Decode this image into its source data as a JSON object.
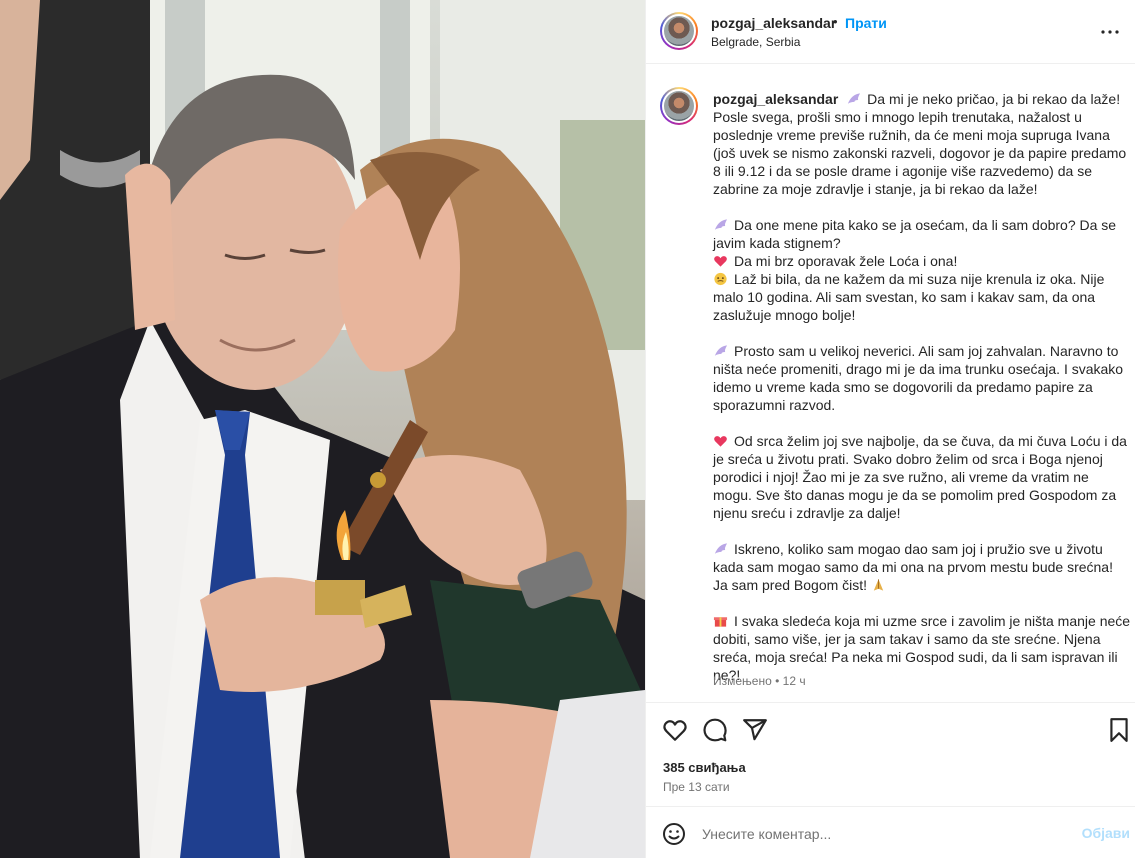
{
  "header": {
    "username": "pozgaj_aleksandar",
    "separator": "•",
    "follow_label": "Прати",
    "location": "Belgrade, Serbia",
    "more_icon": "more-horizontal-icon"
  },
  "caption": {
    "username": "pozgaj_aleksandar",
    "paragraphs": [
      {
        "emoji": "wing-icon",
        "text": "Da mi je neko pričao, ja bi rekao da laže! Posle svega, prošli smo i mnogo lepih trenutaka, nažalost u poslednje vreme previše ružnih, da će meni moja supruga Ivana (još uvek se nismo zakonski razveli, dogovor je da papire predamo 8 ili 9.12 i da se posle drame i agonije više razvedemo) da se zabrine za moje zdravlje i stanje, ja bi rekao da laže!"
      },
      {
        "emoji": "wing-icon",
        "text": "Da one mene pita kako se ja osećam, da li sam dobro? Da se javim kada stignem?",
        "lines": [
          {
            "emoji": "heart-icon",
            "text": "Da mi brz oporavak žele Loća i ona!"
          },
          {
            "emoji": "face-icon",
            "text": "Laž bi bila, da ne kažem da mi suza nije krenula iz oka. Nije malo 10 godina. Ali sam svestan, ko sam i kakav sam, da ona zaslužuje mnogo bolje!"
          }
        ]
      },
      {
        "emoji": "wing-icon",
        "text": "Prosto sam u velikoj neverici. Ali sam joj zahvalan. Naravno to ništa neće promeniti, drago mi je da ima trunku osećaja. I svakako idemo u vreme kada smo se dogovorili da predamo papire za sporazumni razvod."
      },
      {
        "emoji": "heart-icon",
        "text": "Od srca želim joj sve najbolje, da se čuva, da mi čuva Loću i da je sreća u životu prati. Svako dobro želim od srca i Boga njenoj porodici i njoj! Žao mi je za sve ružno, ali vreme da vratim ne mogu. Sve što danas mogu je da se pomolim pred Gospodom za njenu sreću i zdravlje za dalje!"
      },
      {
        "emoji": "wing-icon",
        "text": "Iskreno, koliko sam mogao dao sam joj i pružio sve u životu kada sam mogao samo da mi ona na prvom mestu bude srećna! Ja sam pred Bogom čist!",
        "trail_emoji": "pray-icon"
      },
      {
        "emoji": "gift-icon",
        "text": "I svaka sledeća koja mi uzme srce i zavolim je ništa manje neće dobiti, samo više, jer ja sam takav i samo da ste srećne. Njena sreća, moja sreća! Pa neka mi Gospod sudi, da li sam ispravan ili ne?!"
      }
    ],
    "edited_label": "Измењено",
    "edited_separator": "•",
    "edited_time": "12 ч"
  },
  "actions": {
    "like_icon": "heart-outline-icon",
    "comment_icon": "comment-icon",
    "share_icon": "send-icon",
    "save_icon": "bookmark-icon",
    "likes": "385 свиђања",
    "posted": "Пре 13 сати"
  },
  "comment": {
    "emoji_icon": "smile-icon",
    "placeholder": "Унесите коментар...",
    "post_label": "Објави"
  },
  "colors": {
    "accent": "#0095f6",
    "accent_disabled": "#b2dffc",
    "text": "#262626",
    "muted": "#737373",
    "border": "#efefef"
  }
}
